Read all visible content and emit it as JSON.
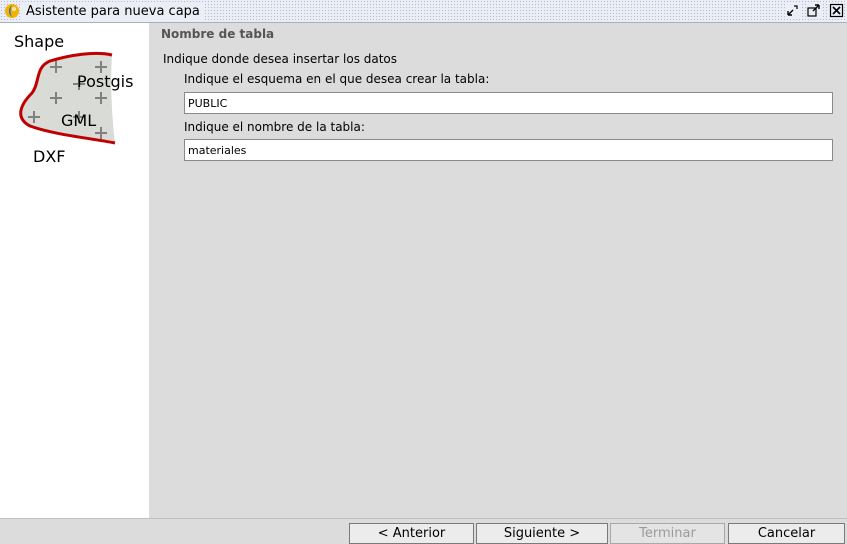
{
  "window": {
    "title": "Asistente para nueva capa"
  },
  "left_panel": {
    "labels": {
      "shape": "Shape",
      "postgis": "Postgis",
      "gml": "GML",
      "dxf": "DXF"
    }
  },
  "form": {
    "section_title": "Nombre de tabla",
    "intro": "Indique donde desea insertar los datos",
    "schema_label": "Indique el esquema en el que desea crear la tabla:",
    "schema_value": "PUBLIC",
    "table_label": "Indique el nombre de la tabla:",
    "table_value": "materiales"
  },
  "buttons": {
    "previous": "< Anterior",
    "next": "Siguiente >",
    "finish": "Terminar",
    "cancel": "Cancelar"
  }
}
